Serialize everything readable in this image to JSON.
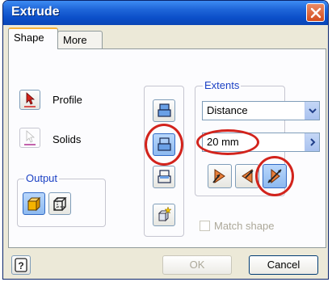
{
  "window": {
    "title": "Extrude"
  },
  "tabs": [
    {
      "label": "Shape",
      "active": true
    },
    {
      "label": "More",
      "active": false
    }
  ],
  "selection": {
    "profile_label": "Profile",
    "solids_label": "Solids"
  },
  "output": {
    "legend": "Output",
    "modes": [
      "solid-icon",
      "surface-icon"
    ],
    "selected": "solid-icon"
  },
  "operations": {
    "items": [
      "join-icon",
      "cut-icon",
      "intersect-icon",
      "new-solid-icon"
    ],
    "selected": "cut-icon"
  },
  "extents": {
    "legend": "Extents",
    "type_value": "Distance",
    "distance_value": "20 mm",
    "directions": [
      "direction-1-icon",
      "direction-2-icon",
      "symmetric-icon"
    ],
    "selected_direction": "symmetric-icon"
  },
  "match_shape": {
    "label": "Match shape",
    "checked": false,
    "enabled": false
  },
  "buttons": {
    "ok": "OK",
    "cancel": "Cancel",
    "help": "?"
  },
  "colors": {
    "accent": "#d2231c",
    "title_blue": "#0b4fc9",
    "legend_blue": "#1c41c4"
  }
}
